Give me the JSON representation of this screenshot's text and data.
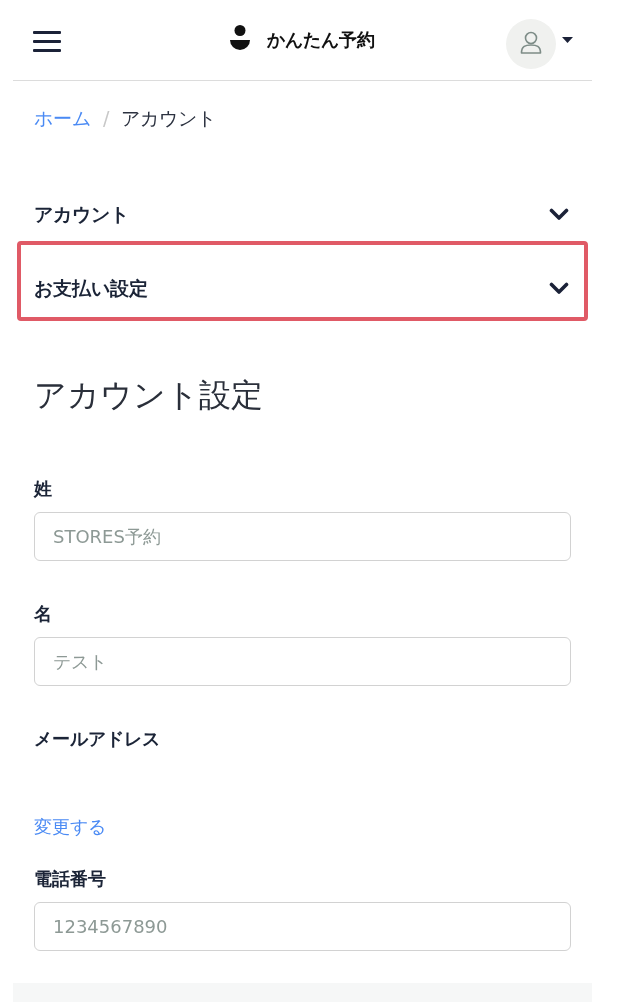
{
  "header": {
    "brand": "かんたん予約"
  },
  "breadcrumb": {
    "separator": "/",
    "items": [
      {
        "label": "ホーム",
        "kind": "link"
      },
      {
        "label": "アカウント",
        "kind": "current"
      }
    ]
  },
  "accordion": [
    {
      "label": "アカウント",
      "expanded": false,
      "highlighted": false
    },
    {
      "label": "お支払い設定",
      "expanded": false,
      "highlighted": true
    }
  ],
  "form": {
    "title": "アカウント設定",
    "fields": [
      {
        "label": "姓",
        "kind": "input",
        "placeholder": "STORES予約"
      },
      {
        "label": "名",
        "kind": "input",
        "placeholder": "テスト"
      },
      {
        "label": "メールアドレス",
        "kind": "email",
        "link": "変更する"
      },
      {
        "label": "電話番号",
        "kind": "input",
        "placeholder": "1234567890"
      }
    ]
  }
}
